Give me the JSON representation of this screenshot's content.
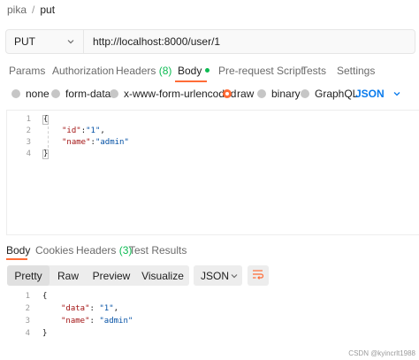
{
  "breadcrumb": {
    "parent": "pika",
    "separator": "/",
    "current": "put"
  },
  "request": {
    "method": "PUT",
    "url": "http://localhost:8000/user/1"
  },
  "request_tabs": {
    "params": "Params",
    "authorization": "Authorization",
    "headers": "Headers",
    "headers_count": "(8)",
    "body": "Body",
    "pre_request": "Pre-request Script",
    "tests": "Tests",
    "settings": "Settings"
  },
  "body_types": {
    "none": "none",
    "form_data": "form-data",
    "urlencoded": "x-www-form-urlencoded",
    "raw": "raw",
    "binary": "binary",
    "graphql": "GraphQL",
    "selected": "raw",
    "language": "JSON"
  },
  "request_body": {
    "line_numbers": [
      "1",
      "2",
      "3",
      "4"
    ],
    "line1": "{",
    "line2_key": "\"id\"",
    "line2_colon": ":",
    "line2_value": "\"1\"",
    "line2_comma": ",",
    "line3_key": "\"name\"",
    "line3_colon": ":",
    "line3_value": "\"admin\"",
    "line4": "}"
  },
  "response_tabs": {
    "body": "Body",
    "cookies": "Cookies",
    "headers": "Headers",
    "headers_count": "(3)",
    "test_results": "Test Results"
  },
  "response_toolbar": {
    "pretty": "Pretty",
    "raw": "Raw",
    "preview": "Preview",
    "visualize": "Visualize",
    "format": "JSON",
    "selected_view": "Pretty"
  },
  "response_body": {
    "line_numbers": [
      "1",
      "2",
      "3",
      "4"
    ],
    "line1": "{",
    "line2_key": "\"data\"",
    "line2_sep": ": ",
    "line2_value": "\"1\"",
    "line2_comma": ",",
    "line3_key": "\"name\"",
    "line3_sep": ": ",
    "line3_value": "\"admin\"",
    "line4": "}"
  },
  "watermark": "CSDN @kyincrlt1988",
  "colors": {
    "accent": "#ff6c37",
    "count_green": "#0cbb52",
    "link_blue": "#097bed",
    "string_blue": "#0451a5",
    "key_red": "#a31515"
  },
  "icons": {
    "method_dropdown": "chevron-down-icon",
    "language_dropdown": "chevron-down-icon",
    "format_dropdown": "chevron-down-icon",
    "wrap": "wrap-lines-icon"
  }
}
